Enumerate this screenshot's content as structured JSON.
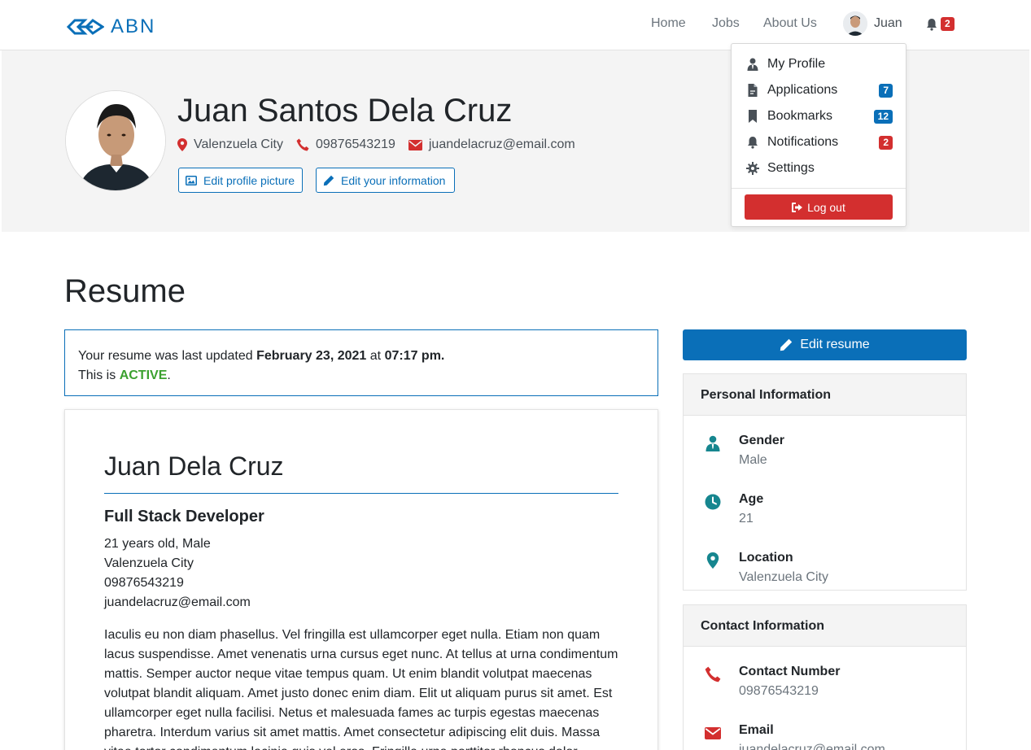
{
  "nav": {
    "logo_text": "ABN",
    "home": "Home",
    "jobs": "Jobs",
    "about": "About Us",
    "user_name": "Juan",
    "notif_count": "2"
  },
  "profile": {
    "full_name": "Juan Santos Dela Cruz",
    "location": "Valenzuela City",
    "phone": "09876543219",
    "email": "juandelacruz@email.com",
    "edit_picture_label": "Edit profile picture",
    "edit_info_label": "Edit your information"
  },
  "dropdown": {
    "items": [
      {
        "label": "My Profile",
        "badge": ""
      },
      {
        "label": "Applications",
        "badge": "7"
      },
      {
        "label": "Bookmarks",
        "badge": "12"
      },
      {
        "label": "Notifications",
        "badge": "2"
      },
      {
        "label": "Settings",
        "badge": ""
      }
    ],
    "logout_label": "Log out"
  },
  "main": {
    "title": "Resume",
    "status_prefix": "Your resume was last updated",
    "status_date": "February 23, 2021",
    "status_at": "at",
    "status_time": "07:17 pm.",
    "status_line2_prefix": "This is",
    "status_state": "ACTIVE",
    "status_line2_suffix": "."
  },
  "resume": {
    "name": "Juan Dela Cruz",
    "role": "Full Stack Developer",
    "age_gender": "21 years old, Male",
    "location": "Valenzuela City",
    "phone": "09876543219",
    "email": "juandelacruz@email.com",
    "summary": "Iaculis eu non diam phasellus. Vel fringilla est ullamcorper eget nulla. Etiam non quam lacus suspendisse. Amet venenatis urna cursus eget nunc. At tellus at urna condimentum mattis. Semper auctor neque vitae tempus quam. Ut enim blandit volutpat maecenas volutpat blandit aliquam. Amet justo donec enim diam. Elit ut aliquam purus sit amet. Est ullamcorper eget nulla facilisi. Netus et malesuada fames ac turpis egestas maecenas pharetra. Interdum varius sit amet mattis. Amet consectetur adipiscing elit duis. Massa vitae tortor condimentum lacinia quis vel eros. Fringilla urna porttitor rhoncus dolor."
  },
  "sidebar": {
    "edit_resume_label": "Edit resume",
    "personal": {
      "heading": "Personal Information",
      "gender_label": "Gender",
      "gender_value": "Male",
      "age_label": "Age",
      "age_value": "21",
      "location_label": "Location",
      "location_value": "Valenzuela City"
    },
    "contact": {
      "heading": "Contact Information",
      "number_label": "Contact Number",
      "number_value": "09876543219",
      "email_label": "Email",
      "email_value": "juandelacruz@email.com"
    }
  },
  "colors": {
    "brand_blue": "#0a6fb8",
    "danger_red": "#d32f2f",
    "active_green": "#3ba12f",
    "teal_icon": "#16868f"
  }
}
